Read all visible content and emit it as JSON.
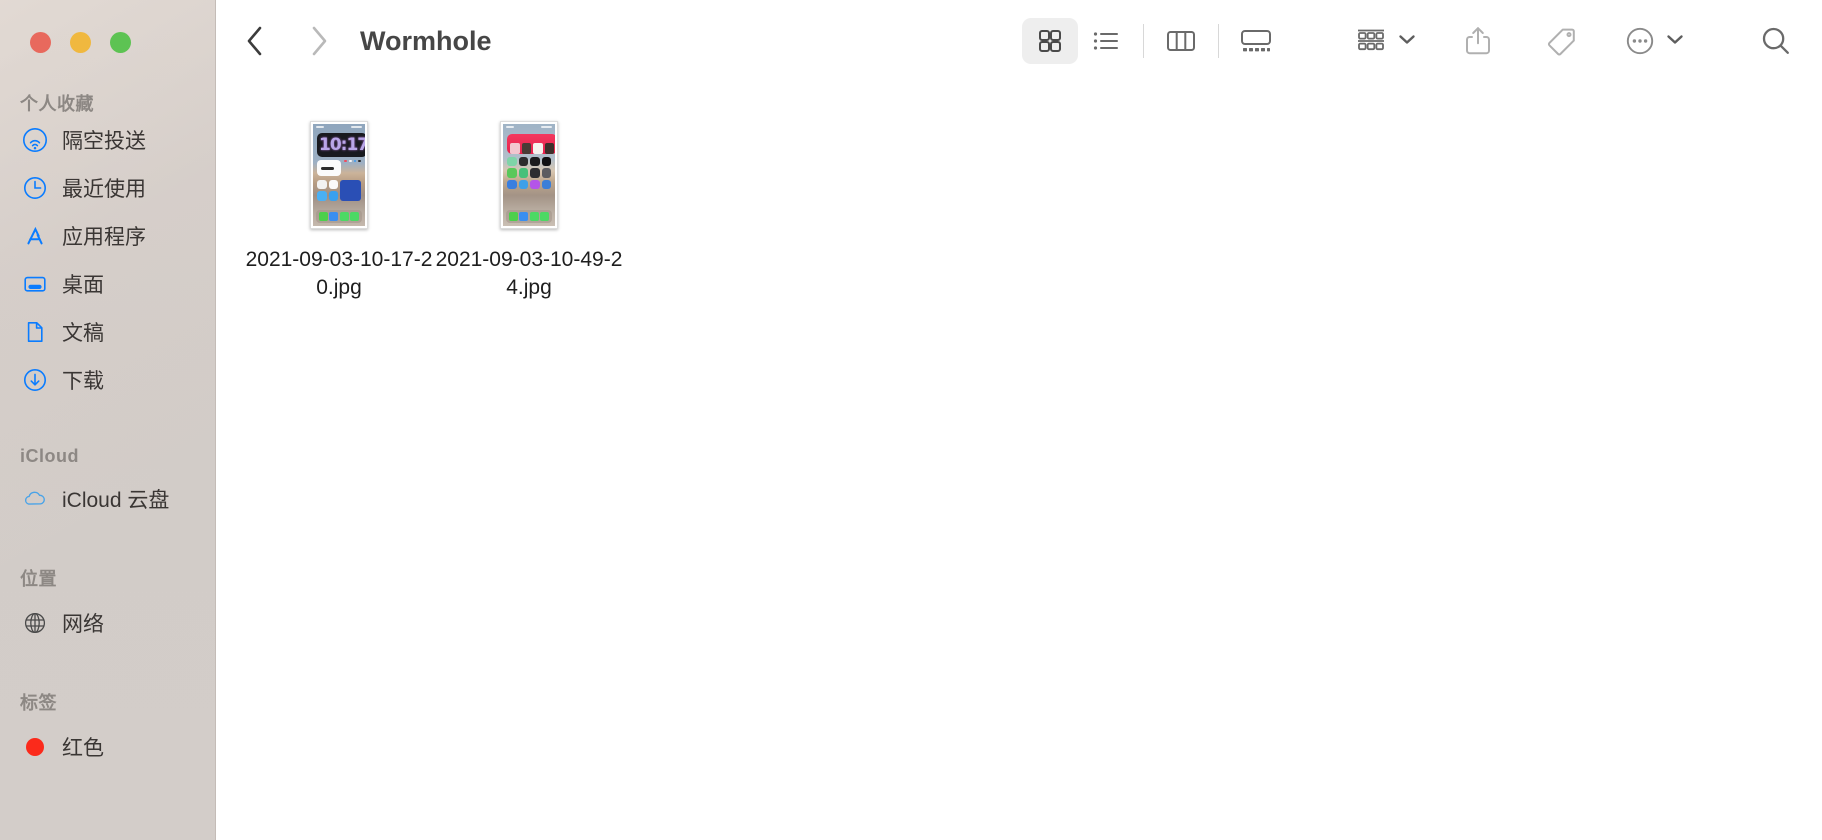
{
  "window": {
    "title": "Wormhole",
    "traffic_lights": [
      {
        "name": "close",
        "color": "#e8695d"
      },
      {
        "name": "minimize",
        "color": "#f0b83f"
      },
      {
        "name": "maximize",
        "color": "#5dc353"
      }
    ]
  },
  "sidebar": {
    "groups": [
      {
        "title": "个人收藏",
        "items": [
          {
            "label": "隔空投送",
            "icon": "airdrop-icon"
          },
          {
            "label": "最近使用",
            "icon": "clock-icon"
          },
          {
            "label": "应用程序",
            "icon": "applications-icon"
          },
          {
            "label": "桌面",
            "icon": "desktop-icon"
          },
          {
            "label": "文稿",
            "icon": "documents-icon"
          },
          {
            "label": "下载",
            "icon": "downloads-icon"
          }
        ]
      },
      {
        "title": "iCloud",
        "items": [
          {
            "label": "iCloud 云盘",
            "icon": "cloud-icon"
          }
        ]
      },
      {
        "title": "位置",
        "items": [
          {
            "label": "网络",
            "icon": "globe-icon"
          }
        ]
      },
      {
        "title": "标签",
        "items": [
          {
            "label": "红色",
            "icon": "tag-dot-icon",
            "color": "#fb2a1b"
          }
        ]
      }
    ]
  },
  "toolbar": {
    "back_label": "后退",
    "forward_label": "前进",
    "back_enabled": true,
    "forward_enabled": false,
    "view_modes": [
      {
        "name": "icon-view",
        "label": "图标显示",
        "selected": true
      },
      {
        "name": "list-view",
        "label": "列表显示",
        "selected": false
      },
      {
        "name": "column-view",
        "label": "分栏显示",
        "selected": false
      },
      {
        "name": "gallery-view",
        "label": "画廊显示",
        "selected": false
      }
    ],
    "group_by_label": "分组",
    "share_label": "共享",
    "tags_label": "标记",
    "more_label": "更多",
    "search_label": "搜索",
    "selected_highlight_color": "#eeeeee"
  },
  "files": [
    {
      "name": "2021-09-03-10-17-20.jpg",
      "type": "jpg",
      "selected": false,
      "thumbnail": "iphone-home-screen-clock-widget"
    },
    {
      "name": "2021-09-03-10-49-24.jpg",
      "type": "jpg",
      "selected": false,
      "thumbnail": "iphone-home-screen-photos-widget"
    }
  ],
  "theme": {
    "sidebar_bg": "#d3cdc9",
    "content_bg": "#ffffff",
    "title_color": "#464646",
    "accent_blue": "#0a7cff"
  }
}
